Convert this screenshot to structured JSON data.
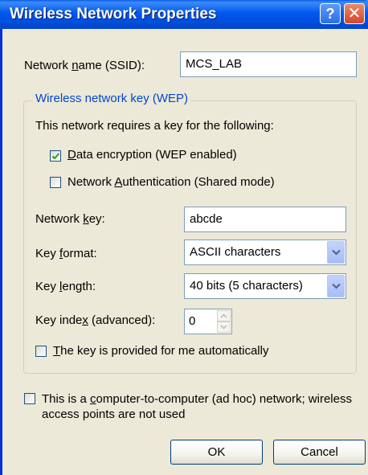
{
  "window": {
    "title": "Wireless Network Properties",
    "help_glyph": "?",
    "close_glyph": "✕"
  },
  "ssid": {
    "label_pre": "Network ",
    "label_u": "n",
    "label_post": "ame (SSID):",
    "value": "MCS_LAB"
  },
  "wep": {
    "legend": "Wireless network key (WEP)",
    "intro": "This network requires a key for the following:",
    "data_encryption": {
      "u": "D",
      "rest": "ata encryption (WEP enabled)",
      "checked": true
    },
    "network_auth": {
      "pre": "Network ",
      "u": "A",
      "post": "uthentication (Shared mode)",
      "checked": false
    },
    "network_key": {
      "pre": "Network ",
      "u": "k",
      "post": "ey:",
      "value": "abcde"
    },
    "key_format": {
      "pre": "Key ",
      "u": "f",
      "post": "ormat:",
      "value": "ASCII characters"
    },
    "key_length": {
      "pre": "Key ",
      "u": "l",
      "post": "ength:",
      "value": "40 bits (5 characters)"
    },
    "key_index": {
      "pre": "Key inde",
      "u": "x",
      "post": " (advanced):",
      "value": "0"
    },
    "auto_key": {
      "u": "T",
      "rest": "he key is provided for me automatically",
      "checked": false
    }
  },
  "adhoc": {
    "line1_pre": "This is a ",
    "line1_u": "c",
    "line1_post": "omputer-to-computer (ad hoc) network; wireless",
    "line2": "access points are not used",
    "checked": false
  },
  "buttons": {
    "ok": "OK",
    "cancel": "Cancel"
  },
  "colors": {
    "titlebar": "#0058ee",
    "group_legend": "#0046d5",
    "window_bg": "#ece9d8"
  }
}
